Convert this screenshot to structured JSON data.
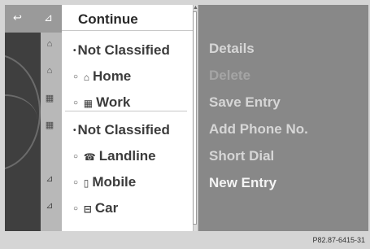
{
  "list": {
    "header": "Continue",
    "rows": [
      {
        "label": "Not Classified",
        "bullet": "•",
        "type_icon": "",
        "strip_icon": "⌂"
      },
      {
        "label": "Home",
        "bullet": "○",
        "type_icon": "⌂",
        "strip_icon": "⌂"
      },
      {
        "label": "Work",
        "bullet": "○",
        "type_icon": "▦",
        "strip_icon": "▦"
      },
      {
        "label": "Not Classified",
        "bullet": "•",
        "type_icon": "",
        "strip_icon": "▦"
      },
      {
        "label": "Landline",
        "bullet": "○",
        "type_icon": "☎",
        "strip_icon": ""
      },
      {
        "label": "Mobile",
        "bullet": "○",
        "type_icon": "▯",
        "strip_icon": "⊿"
      },
      {
        "label": "Car",
        "bullet": "○",
        "type_icon": "⊟",
        "strip_icon": "⊿"
      }
    ]
  },
  "top_icons": {
    "back": "↩",
    "contacts": "⊿"
  },
  "menu": {
    "items": [
      {
        "label": "Details",
        "state": "normal"
      },
      {
        "label": "Delete",
        "state": "disabled"
      },
      {
        "label": "Save Entry",
        "state": "normal"
      },
      {
        "label": "Add Phone No.",
        "state": "normal"
      },
      {
        "label": "Short Dial",
        "state": "normal"
      },
      {
        "label": "New Entry",
        "state": "selected"
      }
    ]
  },
  "caption": "P82.87-6415-31",
  "colors": {
    "screen_bg": "#858585",
    "list_bg": "#ffffff",
    "menu_text": "#d6d6d6",
    "menu_disabled": "#a5a5a5",
    "menu_selected": "#f4f4f4"
  }
}
